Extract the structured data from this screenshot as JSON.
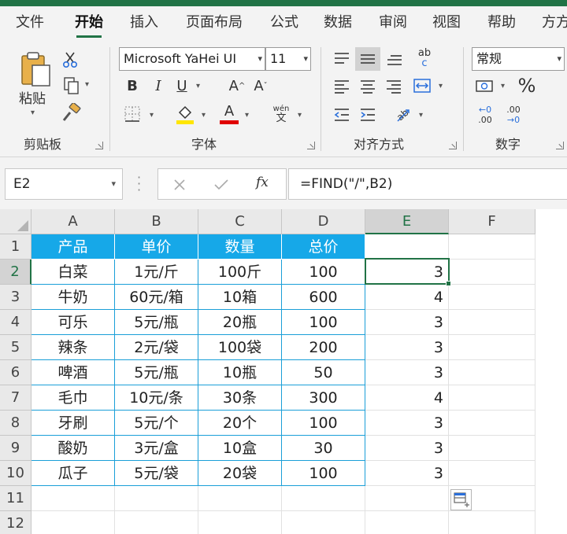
{
  "menu": {
    "items": [
      {
        "label": "文件"
      },
      {
        "label": "开始",
        "active": true
      },
      {
        "label": "插入"
      },
      {
        "label": "页面布局"
      },
      {
        "label": "公式"
      },
      {
        "label": "数据"
      },
      {
        "label": "审阅"
      },
      {
        "label": "视图"
      },
      {
        "label": "帮助"
      },
      {
        "label": "方方"
      }
    ]
  },
  "ribbon": {
    "clipboard": {
      "paste_label": "粘贴",
      "group_label": "剪贴板"
    },
    "font": {
      "font_name": "Microsoft YaHei UI",
      "font_size": "11",
      "bold": "B",
      "italic": "I",
      "underline": "U",
      "grow": "A",
      "shrink": "A",
      "font_color_letter": "A",
      "phonetic_top": "wén",
      "phonetic_bottom": "文",
      "fill_color": "#ffe600",
      "font_color": "#e00000",
      "group_label": "字体"
    },
    "alignment": {
      "group_label": "对齐方式",
      "wrap_top": "ab",
      "wrap_bottom": "c"
    },
    "number": {
      "format": "常规",
      "percent": "%",
      "inc_top": "←0",
      "inc_bottom": ".00",
      "dec_top": ".00",
      "dec_bottom": "→0",
      "group_label": "数字"
    }
  },
  "formula_bar": {
    "name_box": "E2",
    "formula": "=FIND(\"/\",B2)"
  },
  "grid": {
    "columns": [
      "A",
      "B",
      "C",
      "D",
      "E",
      "F"
    ],
    "rows": [
      "1",
      "2",
      "3",
      "4",
      "5",
      "6",
      "7",
      "8",
      "9",
      "10",
      "11",
      "12"
    ],
    "headers": [
      "产品",
      "单价",
      "数量",
      "总价"
    ],
    "data": [
      [
        "白菜",
        "1元/斤",
        "100斤",
        "100",
        "3"
      ],
      [
        "牛奶",
        "60元/箱",
        "10箱",
        "600",
        "4"
      ],
      [
        "可乐",
        "5元/瓶",
        "20瓶",
        "100",
        "3"
      ],
      [
        "辣条",
        "2元/袋",
        "100袋",
        "200",
        "3"
      ],
      [
        "啤酒",
        "5元/瓶",
        "10瓶",
        "50",
        "3"
      ],
      [
        "毛巾",
        "10元/条",
        "30条",
        "300",
        "4"
      ],
      [
        "牙刷",
        "5元/个",
        "20个",
        "100",
        "3"
      ],
      [
        "酸奶",
        "3元/盒",
        "10盒",
        "30",
        "3"
      ],
      [
        "瓜子",
        "5元/袋",
        "20袋",
        "100",
        "3"
      ]
    ],
    "selected_cell": "E2",
    "header_color": "#16a8e8",
    "accent": "#217346"
  }
}
